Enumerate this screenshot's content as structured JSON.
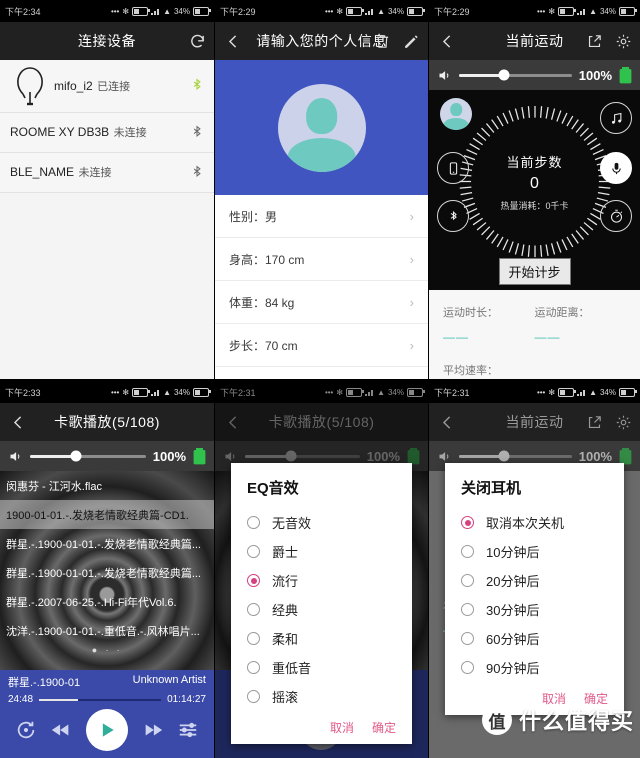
{
  "status_bar": {
    "time_p1": "下午2:34",
    "time_p2": "下午2:29",
    "time_p3": "下午2:29",
    "time_p4": "下午2:33",
    "time_p5": "下午2:31",
    "time_p6": "下午2:31",
    "battery_pct": "34%"
  },
  "panel_devices": {
    "title": "连接设备",
    "refresh_icon": "refresh-icon",
    "items": [
      {
        "name": "mifo_i2",
        "state": "已连接",
        "connected": true
      },
      {
        "name": "ROOME XY DB3B",
        "state": "未连接",
        "connected": false
      },
      {
        "name": "BLE_NAME",
        "state": "未连接",
        "connected": false
      }
    ]
  },
  "panel_profile": {
    "title": "请输入您的个人信息",
    "back_icon": "back-icon",
    "delete_icon": "trash-icon",
    "edit_icon": "pencil-icon",
    "avatar_icon": "avatar-icon",
    "rows": [
      {
        "label": "性别：男"
      },
      {
        "label": "身高：170 cm"
      },
      {
        "label": "体重：84 kg"
      },
      {
        "label": "步长：70 cm"
      }
    ]
  },
  "panel_sport": {
    "title": "当前运动",
    "back_icon": "back-icon",
    "share_icon": "share-icon",
    "settings_icon": "gear-icon",
    "volume": {
      "icon": "volume-icon",
      "percent": "100%",
      "battery_icon": "battery-full-icon"
    },
    "dial": {
      "label": "当前步数",
      "value": "0",
      "calories": "热量消耗：0千卡"
    },
    "start_button": "开始计步",
    "side_icons": [
      "music-note-icon",
      "microphone-icon",
      "stopwatch-icon",
      "phone-icon",
      "bluetooth-icon"
    ],
    "stats": [
      {
        "label": "运动时长：",
        "value": "——"
      },
      {
        "label": "运动距离：",
        "value": "——"
      },
      {
        "label": "平均速率：",
        "value": "——"
      }
    ]
  },
  "panel_player": {
    "title": "卡歌播放(5/108)",
    "back_icon": "back-icon",
    "volume": {
      "icon": "volume-icon",
      "percent": "100%",
      "battery_icon": "battery-full-icon"
    },
    "playlist": [
      {
        "text": "闵惠芬 - 江河水.flac",
        "selected": false
      },
      {
        "text": "1900-01-01.-.发烧老情歌经典篇-CD1.",
        "selected": true
      },
      {
        "text": "群星.-.1900-01-01.-.发烧老情歌经典篇...",
        "selected": false
      },
      {
        "text": "群星.-.1900-01-01.-.发烧老情歌经典篇...",
        "selected": false
      },
      {
        "text": "群星.-.2007-06-25.-.Hi-Fi年代Vol.6.",
        "selected": false
      },
      {
        "text": "沈洋.-.1900-01-01.-.重低音.-.风林唱片...",
        "selected": false
      }
    ],
    "page_dots": "● ∙ ∙",
    "now_playing": {
      "title": "群星.-.1900-01",
      "artist": "Unknown Artist",
      "elapsed": "24:48",
      "total": "01:14:27"
    },
    "controls": {
      "repeat_icon": "repeat-icon",
      "prev_icon": "rewind-icon",
      "play_icon": "play-icon",
      "pause_icon": "pause-icon",
      "next_icon": "fast-forward-icon",
      "eq_icon": "equalizer-icon"
    }
  },
  "dialog_eq": {
    "title": "EQ音效",
    "options": [
      {
        "label": "无音效",
        "selected": false
      },
      {
        "label": "爵士",
        "selected": false
      },
      {
        "label": "流行",
        "selected": true
      },
      {
        "label": "经典",
        "selected": false
      },
      {
        "label": "柔和",
        "selected": false
      },
      {
        "label": "重低音",
        "selected": false
      },
      {
        "label": "摇滚",
        "selected": false
      }
    ],
    "cancel": "取消",
    "confirm": "确定"
  },
  "dialog_sleep": {
    "title": "关闭耳机",
    "options": [
      {
        "label": "取消本次关机",
        "selected": true
      },
      {
        "label": "10分钟后",
        "selected": false
      },
      {
        "label": "20分钟后",
        "selected": false
      },
      {
        "label": "30分钟后",
        "selected": false
      },
      {
        "label": "60分钟后",
        "selected": false
      },
      {
        "label": "90分钟后",
        "selected": false
      }
    ],
    "cancel": "取消",
    "confirm": "确定"
  },
  "watermark": {
    "logo": "值",
    "text": "什么值得买"
  },
  "colors": {
    "accent_blue": "#3b4aa8",
    "hero_blue": "#4055c0",
    "teal": "#3fbfb0",
    "pink": "#d6417f",
    "dark": "#212121"
  }
}
